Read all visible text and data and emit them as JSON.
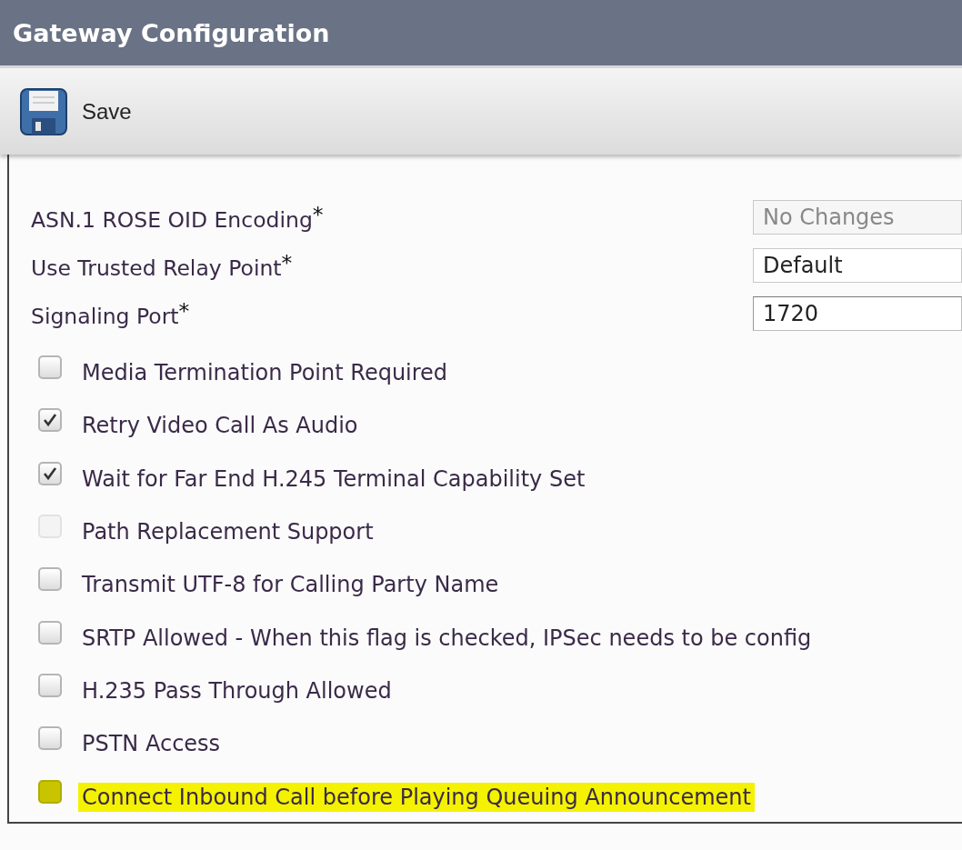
{
  "window": {
    "title": "Gateway Configuration"
  },
  "toolbar": {
    "buttons": [
      {
        "label": "Save"
      }
    ]
  },
  "fields": [
    {
      "label": "ASN.1 ROSE OID Encoding",
      "required_mark": "*",
      "kind": "select",
      "value": "No Changes",
      "disabled": true
    },
    {
      "label": "Use Trusted Relay Point",
      "required_mark": "*",
      "kind": "select",
      "value": "Default",
      "disabled": false
    },
    {
      "label": "Signaling Port",
      "required_mark": "*",
      "kind": "text",
      "value": "1720",
      "disabled": false
    }
  ],
  "checkboxes": [
    {
      "label": "Media Termination Point Required",
      "checked": false,
      "disabled": false,
      "highlighted": false
    },
    {
      "label": "Retry Video Call As Audio",
      "checked": true,
      "disabled": false,
      "highlighted": false
    },
    {
      "label": "Wait for Far End H.245 Terminal Capability Set",
      "checked": true,
      "disabled": false,
      "highlighted": false
    },
    {
      "label": "Path Replacement Support",
      "checked": false,
      "disabled": true,
      "highlighted": false
    },
    {
      "label": "Transmit UTF-8 for Calling Party Name",
      "checked": false,
      "disabled": false,
      "highlighted": false
    },
    {
      "label": "SRTP Allowed - When this flag is checked, IPSec needs to be config",
      "checked": false,
      "disabled": false,
      "highlighted": false
    },
    {
      "label": "H.235 Pass Through Allowed",
      "checked": false,
      "disabled": false,
      "highlighted": false
    },
    {
      "label": "PSTN Access",
      "checked": false,
      "disabled": false,
      "highlighted": false
    },
    {
      "label": "Connect Inbound Call before Playing Queuing Announcement",
      "checked": false,
      "disabled": false,
      "highlighted": true
    }
  ]
}
